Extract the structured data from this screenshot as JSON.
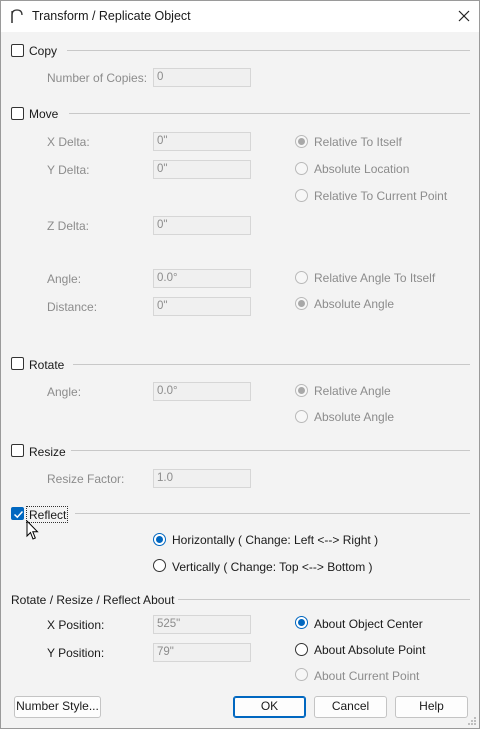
{
  "window": {
    "title": "Transform / Replicate Object",
    "icon": "chief-architect-arc-icon",
    "close_icon": "close-icon"
  },
  "copy": {
    "label": "Copy",
    "checked": false,
    "number_of_copies_label": "Number of Copies:",
    "number_of_copies_value": "0"
  },
  "move": {
    "label": "Move",
    "checked": false,
    "x_delta_label": "X Delta:",
    "x_delta_value": "0\"",
    "y_delta_label": "Y Delta:",
    "y_delta_value": "0\"",
    "z_delta_label": "Z Delta:",
    "z_delta_value": "0\"",
    "relative_to_itself": "Relative To Itself",
    "absolute_location": "Absolute Location",
    "relative_to_current_point": "Relative To Current Point",
    "angle_label": "Angle:",
    "angle_value": "0.0°",
    "distance_label": "Distance:",
    "distance_value": "0\"",
    "relative_angle_to_itself": "Relative Angle To Itself",
    "absolute_angle": "Absolute Angle"
  },
  "rotate": {
    "label": "Rotate",
    "checked": false,
    "angle_label": "Angle:",
    "angle_value": "0.0°",
    "relative_angle": "Relative Angle",
    "absolute_angle": "Absolute Angle"
  },
  "resize": {
    "label": "Resize",
    "checked": false,
    "factor_label": "Resize Factor:",
    "factor_value": "1.0"
  },
  "reflect": {
    "label": "Reflect",
    "checked": true,
    "horizontally": "Horizontally ( Change: Left <--> Right )",
    "vertically": "Vertically ( Change: Top <--> Bottom )",
    "selected": "horizontally"
  },
  "about": {
    "label": "Rotate / Resize / Reflect About",
    "x_position_label": "X Position:",
    "x_position_value": "525\"",
    "y_position_label": "Y Position:",
    "y_position_value": "79\"",
    "about_object_center": "About Object Center",
    "about_absolute_point": "About Absolute Point",
    "about_current_point": "About Current Point",
    "selected": "about_object_center"
  },
  "buttons": {
    "number_style": "Number Style...",
    "ok": "OK",
    "cancel": "Cancel",
    "help": "Help"
  },
  "colors": {
    "accent": "#0067c0",
    "disabled_text": "#8c8c8c",
    "background": "#f3f3f3"
  }
}
